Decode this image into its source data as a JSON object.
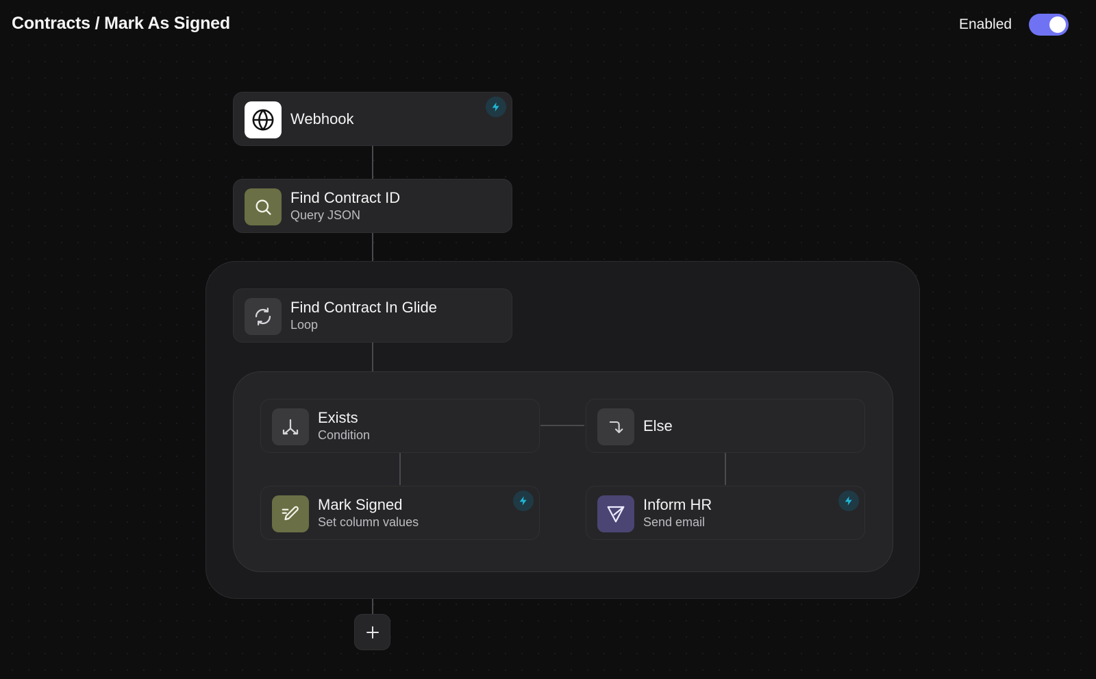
{
  "header": {
    "title": "Contracts / Mark As Signed",
    "enabled_label": "Enabled",
    "enabled": true
  },
  "colors": {
    "toggle_accent": "#6f73f3",
    "bolt_accent": "#1fb7d6",
    "webhook_icon_bg": "#ffffff",
    "query_icon_bg": "#6b6f45",
    "set_column_icon_bg": "#6b6f45",
    "email_icon_bg": "#4a4573"
  },
  "nodes": {
    "webhook": {
      "title": "Webhook",
      "icon": "globe-icon",
      "has_trigger": true
    },
    "find_contract_id": {
      "title": "Find Contract ID",
      "subtitle": "Query JSON",
      "icon": "search-icon"
    },
    "find_in_glide": {
      "title": "Find Contract In Glide",
      "subtitle": "Loop",
      "icon": "loop-icon"
    },
    "exists": {
      "title": "Exists",
      "subtitle": "Condition",
      "icon": "branch-icon"
    },
    "else": {
      "title": "Else",
      "icon": "turn-down-icon"
    },
    "mark_signed": {
      "title": "Mark Signed",
      "subtitle": "Set column values",
      "icon": "edit-icon",
      "has_trigger": true
    },
    "inform_hr": {
      "title": "Inform HR",
      "subtitle": "Send email",
      "icon": "send-icon",
      "has_trigger": true
    }
  },
  "add_button": {
    "icon": "plus-icon"
  }
}
